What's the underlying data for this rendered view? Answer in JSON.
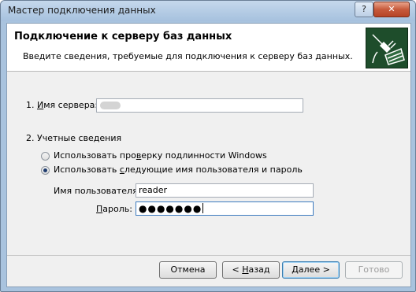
{
  "window": {
    "title": "Мастер подключения данных",
    "help_label": "?",
    "close_label": "✕"
  },
  "header": {
    "title": "Подключение к серверу баз данных",
    "subtitle": "Введите сведения, требуемые для подключения к серверу баз данных.",
    "icon": "database-plug-icon"
  },
  "server": {
    "label_prefix": "1. ",
    "label_u": "И",
    "label_rest": "мя сервера:",
    "value": ""
  },
  "credentials": {
    "heading": "2. Учетные сведения",
    "option_windows": {
      "pre": "Использовать про",
      "u": "в",
      "post": "ерку подлинности Windows",
      "selected": false
    },
    "option_user": {
      "pre": "Использовать ",
      "u": "с",
      "post": "ледующие имя пользователя и пароль",
      "selected": true
    },
    "username": {
      "label": "Имя пользователя:",
      "value": "reader"
    },
    "password": {
      "label_u": "П",
      "label_rest": "ароль:",
      "value": "●●●●●●●"
    }
  },
  "buttons": {
    "cancel": "Отмена",
    "back_pre": "< ",
    "back_u": "Н",
    "back_post": "азад",
    "next_pre": "",
    "next_u": "Д",
    "next_post": "алее >",
    "finish": "Готово"
  }
}
